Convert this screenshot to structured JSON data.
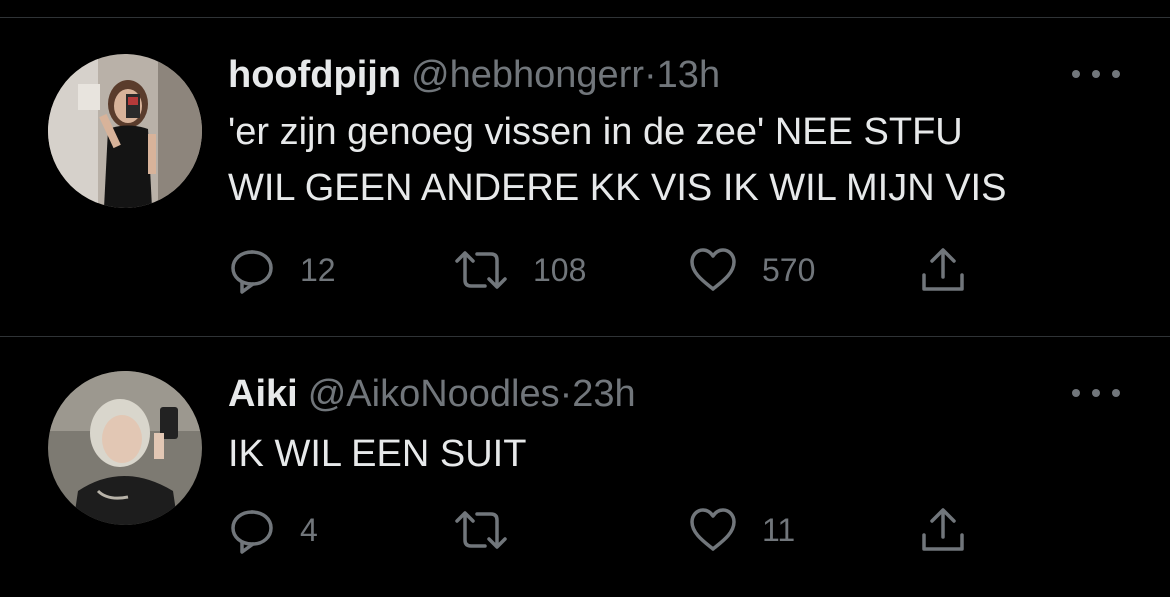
{
  "timeline": {
    "tweets": [
      {
        "display_name": "hoofdpijn",
        "handle": "@hebhongerr",
        "separator": "·",
        "time": "13h",
        "text": "'er zijn genoeg vissen in de zee' NEE STFU\nWIL GEEN ANDERE KK VIS IK WIL MIJN VIS",
        "replies": "12",
        "retweets": "108",
        "likes": "570",
        "avatar_icon": "profile-photo"
      },
      {
        "display_name": "Aiki",
        "handle": "@AikoNoodles",
        "separator": "·",
        "time": "23h",
        "text": "IK WIL EEN SUIT",
        "replies": "4",
        "retweets": "",
        "likes": "11",
        "avatar_icon": "profile-photo"
      }
    ]
  },
  "icons": {
    "reply": "speech-bubble-icon",
    "retweet": "retweet-arrows-icon",
    "like": "heart-icon",
    "share": "share-upload-icon",
    "more": "more-dots-icon"
  },
  "colors": {
    "background": "#000000",
    "primary_text": "#e7e9ea",
    "secondary_text": "#71767b",
    "divider": "#2f3336"
  }
}
